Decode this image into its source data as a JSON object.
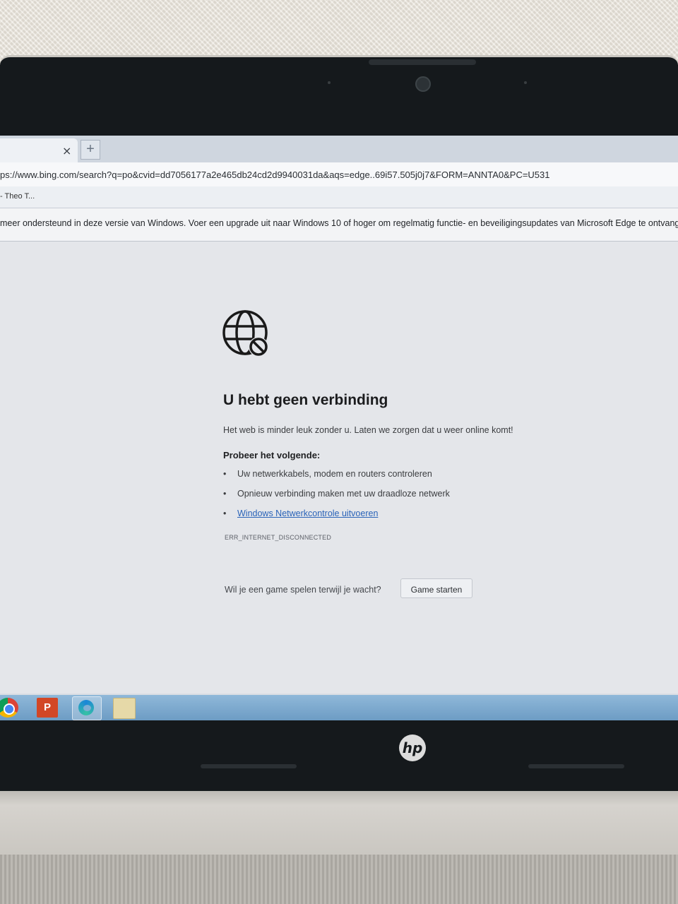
{
  "browser": {
    "tab_close_glyph": "×",
    "new_tab_glyph": "+",
    "url": "ps://www.bing.com/search?q=po&cvid=dd7056177a2e465db24cd2d9940031da&aqs=edge..69i57.505j0j7&FORM=ANNTA0&PC=U531",
    "favorite_item": "- Theo T...",
    "infobar_text": "meer ondersteund in deze versie van Windows. Voer een upgrade uit naar Windows 10 of hoger om regelmatig functie- en beveiligingsupdates van Microsoft Edge te ontvangen."
  },
  "error_page": {
    "icon": "globe-blocked-icon",
    "title": "U hebt geen verbinding",
    "subtitle": "Het web is minder leuk zonder u. Laten we zorgen dat u weer online komt!",
    "try_heading": "Probeer het volgende:",
    "suggestions": [
      "Uw netwerkkabels, modem en routers controleren",
      "Opnieuw verbinding maken met uw draadloze netwerk",
      "Windows Netwerkcontrole uitvoeren"
    ],
    "error_code": "ERR_INTERNET_DISCONNECTED",
    "game_question": "Wil je een game spelen terwijl je wacht?",
    "game_button": "Game starten"
  },
  "taskbar": {
    "items": [
      "chrome-icon",
      "powerpoint-icon",
      "edge-icon",
      "folder-icon"
    ],
    "powerpoint_letter": "P"
  },
  "device": {
    "logo": "hp"
  },
  "colors": {
    "link": "#2a63b8",
    "taskbar": "#7faacf",
    "bezel": "#15191c"
  }
}
